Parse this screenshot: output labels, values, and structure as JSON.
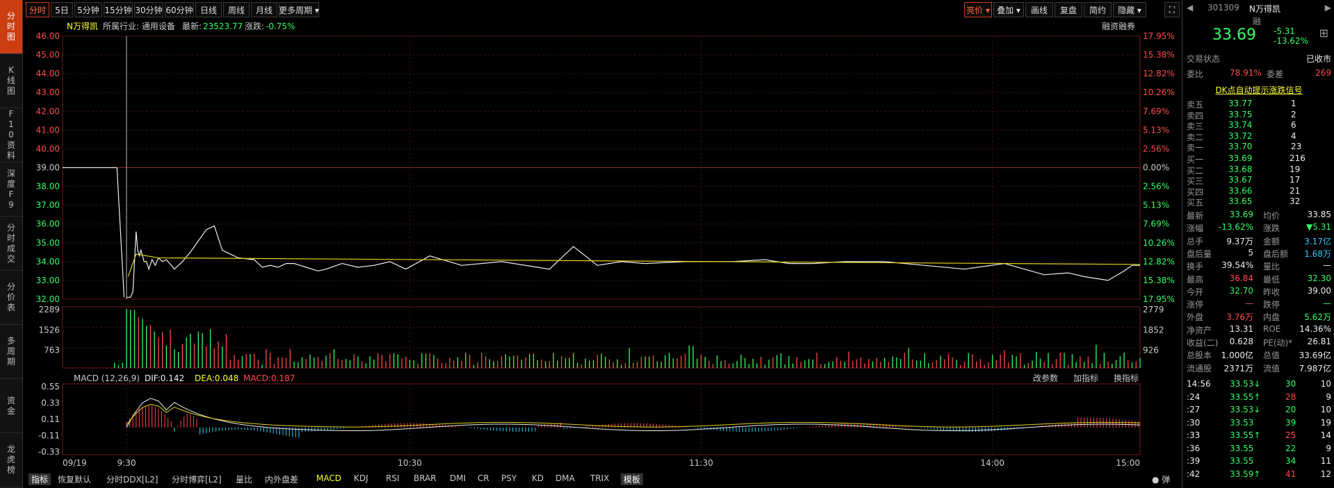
{
  "left_nav": [
    "分时图",
    "K线图",
    "F10资料",
    "深度F9",
    "分时成交",
    "分价表",
    "多周期",
    "资金",
    "龙虎榜"
  ],
  "toolbar": {
    "periods": [
      "分时",
      "5日",
      "5分钟",
      "15分钟",
      "30分钟",
      "60分钟",
      "日线",
      "周线",
      "月线",
      "更多周期"
    ],
    "right": [
      "亮价",
      "叠加",
      "画线",
      "复盘",
      "简约",
      "隐藏"
    ]
  },
  "info": {
    "name": "N万得凯",
    "industry": "所属行业: 通用设备",
    "latest_label": "最新:",
    "latest": "23523.77",
    "change_label": "涨跌:",
    "change": "-0.75%",
    "margin": "融资融券"
  },
  "price_axis": {
    "left": [
      "46.00",
      "45.00",
      "44.00",
      "43.00",
      "42.00",
      "41.00",
      "40.00",
      "39.00",
      "38.00",
      "37.00",
      "36.00",
      "35.00",
      "34.00",
      "33.00",
      "32.00"
    ],
    "right": [
      "17.95%",
      "15.38%",
      "12.82%",
      "10.26%",
      "7.69%",
      "5.13%",
      "2.56%",
      "0.00%",
      "2.56%",
      "5.13%",
      "7.69%",
      "10.26%",
      "12.82%",
      "15.38%",
      "17.95%"
    ]
  },
  "volume_axis": {
    "left": [
      "2289",
      "1526",
      "763"
    ],
    "right": [
      "2779",
      "1852",
      "926"
    ]
  },
  "macd": {
    "title": "MACD (12,26,9)",
    "dif": "DIF:0.142",
    "dea": "DEA:0.048",
    "macd": "MACD:0.187",
    "links": [
      "改参数",
      "加指标",
      "换指标"
    ],
    "axis": [
      "0.55",
      "0.33",
      "0.11",
      "-0.11",
      "-0.33"
    ]
  },
  "time_axis": [
    "09/19",
    "9:30",
    "10:30",
    "11:30",
    "14:00",
    "15:00"
  ],
  "chart_data": {
    "type": "line",
    "price_ylim": [
      32.0,
      46.0
    ],
    "prev_close": 39.0,
    "price_x": [
      0,
      5,
      8,
      10,
      12,
      14,
      16,
      18,
      22,
      25,
      28,
      32,
      36,
      40,
      45,
      50,
      60,
      70,
      80,
      90,
      100,
      110,
      120,
      140,
      160,
      170,
      180,
      190,
      200,
      210,
      225,
      240,
      250,
      270,
      290,
      310,
      330,
      350,
      380,
      420,
      470,
      530,
      560,
      590,
      620,
      650,
      700,
      760,
      800,
      830,
      860,
      900,
      950,
      1000,
      1050,
      1100,
      1150,
      1180,
      1200,
      1230,
      1250,
      1260,
      1270
    ],
    "price_y": [
      32.1,
      32.1,
      32.4,
      34.0,
      35.6,
      34.6,
      34.3,
      34.6,
      34.0,
      34.0,
      33.6,
      34.1,
      33.8,
      34.2,
      34.0,
      34.1,
      33.6,
      34.0,
      34.5,
      35.1,
      35.7,
      35.9,
      34.6,
      34.2,
      34.1,
      33.7,
      33.8,
      33.7,
      33.9,
      33.9,
      33.7,
      33.5,
      33.6,
      33.9,
      33.7,
      33.8,
      34.0,
      33.6,
      34.3,
      33.8,
      34.0,
      33.6,
      34.8,
      33.8,
      34.0,
      33.9,
      34.0,
      34.0,
      34.1,
      33.9,
      33.9,
      34.0,
      34.0,
      33.8,
      33.6,
      33.9,
      33.3,
      33.4,
      33.2,
      33.0,
      33.5,
      33.8,
      33.8
    ],
    "avg_y_start": 34.2,
    "avg_y_end": 33.85
  },
  "bottom_tabs": [
    "指标",
    "恢复默认",
    "分时DDX[L2]",
    "分时博弈[L2]",
    "量比",
    "内外盘差",
    "MACD",
    "KDJ",
    "RSI",
    "BRAR",
    "DMI",
    "CR",
    "PSY",
    "KD",
    "DMA",
    "TRIX",
    "模板"
  ],
  "bottom_right": "弹",
  "quote": {
    "code": "301309",
    "name": "N万得凯",
    "margin_flag": "融",
    "price": "33.69",
    "change": "-5.31",
    "pct": "-13.62%",
    "status_label": "交易状态",
    "status": "已收市",
    "ratio_label": "委比",
    "ratio": "78.91%",
    "diff_label": "委差",
    "diff": "269",
    "dk": "DK点自动提示涨跌信号",
    "asks": [
      {
        "l": "卖五",
        "p": "33.77",
        "v": "1"
      },
      {
        "l": "卖四",
        "p": "33.75",
        "v": "2"
      },
      {
        "l": "卖三",
        "p": "33.74",
        "v": "6"
      },
      {
        "l": "卖二",
        "p": "33.72",
        "v": "4"
      },
      {
        "l": "卖一",
        "p": "33.70",
        "v": "23"
      }
    ],
    "bids": [
      {
        "l": "买一",
        "p": "33.69",
        "v": "216"
      },
      {
        "l": "买二",
        "p": "33.68",
        "v": "19"
      },
      {
        "l": "买三",
        "p": "33.67",
        "v": "17"
      },
      {
        "l": "买四",
        "p": "33.66",
        "v": "21"
      },
      {
        "l": "买五",
        "p": "33.65",
        "v": "32"
      }
    ],
    "stats": [
      [
        "最新",
        "33.69",
        "均价",
        "33.85"
      ],
      [
        "涨幅",
        "-13.62%",
        "涨跌",
        "▼5.31"
      ],
      [
        "总手",
        "9.37万",
        "金额",
        "3.17亿"
      ],
      [
        "盘后量",
        "5",
        "盘后额",
        "1.68万"
      ],
      [
        "换手",
        "39.54%",
        "量比",
        "—"
      ],
      [
        "最高",
        "36.84",
        "最低",
        "32.30"
      ],
      [
        "今开",
        "32.70",
        "昨收",
        "39.00"
      ],
      [
        "涨停",
        "—",
        "跌停",
        "—"
      ],
      [
        "外盘",
        "3.76万",
        "内盘",
        "5.62万"
      ],
      [
        "净资产",
        "13.31",
        "ROE",
        "14.36%"
      ],
      [
        "收益(二)",
        "0.628",
        "PE(动)*",
        "26.81"
      ],
      [
        "总股本",
        "1.000亿",
        "总值",
        "33.69亿"
      ],
      [
        "流通股",
        "2371万",
        "流值",
        "7.987亿"
      ]
    ],
    "ticks": [
      [
        "14:56",
        "33.53↓",
        "30",
        "10"
      ],
      [
        ":24",
        "33.55↑",
        "28",
        "9"
      ],
      [
        ":27",
        "33.53↓",
        "20",
        "10"
      ],
      [
        ":30",
        "33.53",
        "39",
        "19"
      ],
      [
        ":33",
        "33.55↑",
        "25",
        "14"
      ],
      [
        ":36",
        "33.55",
        "22",
        "9"
      ],
      [
        ":39",
        "33.55",
        "34",
        "11"
      ],
      [
        ":42",
        "33.59↑",
        "41",
        "12"
      ]
    ]
  },
  "colors": {
    "red": "#ff4c4c",
    "green": "#33ff66",
    "yellow": "#ffff33",
    "cyan": "#33ccff",
    "accent": "#cc3d14"
  }
}
